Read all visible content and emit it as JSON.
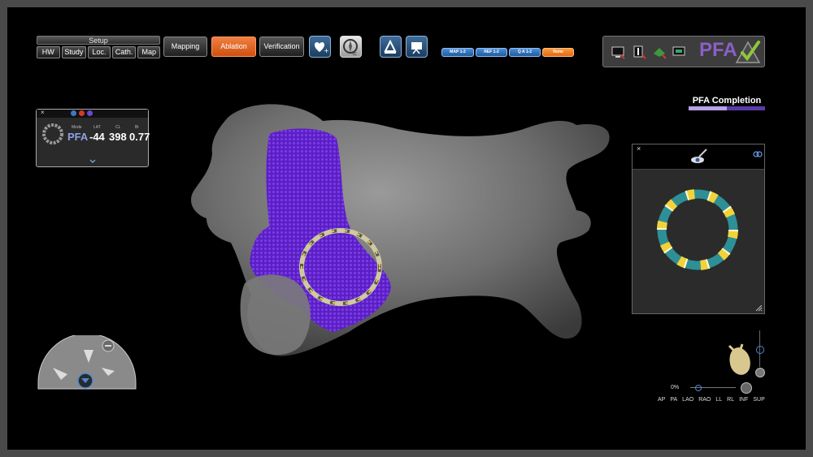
{
  "toolbar": {
    "setup_title": "Setup",
    "setup_items": [
      "HW",
      "Study",
      "Loc.",
      "Cath.",
      "Map"
    ],
    "tabs": [
      {
        "label": "Mapping",
        "active": false
      },
      {
        "label": "Ablation",
        "active": true
      },
      {
        "label": "Verification",
        "active": false
      }
    ],
    "icons": [
      "heart-plus-icon",
      "compass-ic-icon",
      "catheter-icon",
      "camera-icon"
    ],
    "pills": [
      {
        "label": "MAP 1-2",
        "color": "#3b7fd0"
      },
      {
        "label": "REF 1-2",
        "color": "#3b7fd0"
      },
      {
        "label": "Q A 1-2",
        "color": "#3b7fd0"
      },
      {
        "label": "None",
        "color": "#f08a2c"
      }
    ]
  },
  "status_panel": {
    "title": "PFA",
    "icons": [
      "monitor-icon",
      "catheter-status-icon",
      "map-status-icon",
      "display-status-icon",
      "pfa-checkmark-icon"
    ]
  },
  "pfa_completion": {
    "label": "PFA Completion",
    "progress": 0.5
  },
  "mini_panel": {
    "close": "×",
    "mode_label": "Mode",
    "mode_value": "PFA",
    "lat_label": "LAT",
    "lat_value": "-44",
    "cl_label": "CL",
    "cl_value": "398",
    "bi_label": "Bi",
    "bi_value": "0.77"
  },
  "ring_panel": {
    "close": "×",
    "icons": [
      "eye-wand-icon",
      "link-icon",
      "resize-icon"
    ]
  },
  "view_controls": {
    "zoom_label": "0%",
    "views": [
      "AP",
      "PA",
      "LAO",
      "RAO",
      "LL",
      "RL",
      "INF",
      "SUP"
    ]
  },
  "colors": {
    "accent_orange": "#e8601c",
    "pfa_purple": "#6a2fd0",
    "ring_teal": "#2f8f96",
    "ring_yellow": "#f2d23a"
  }
}
